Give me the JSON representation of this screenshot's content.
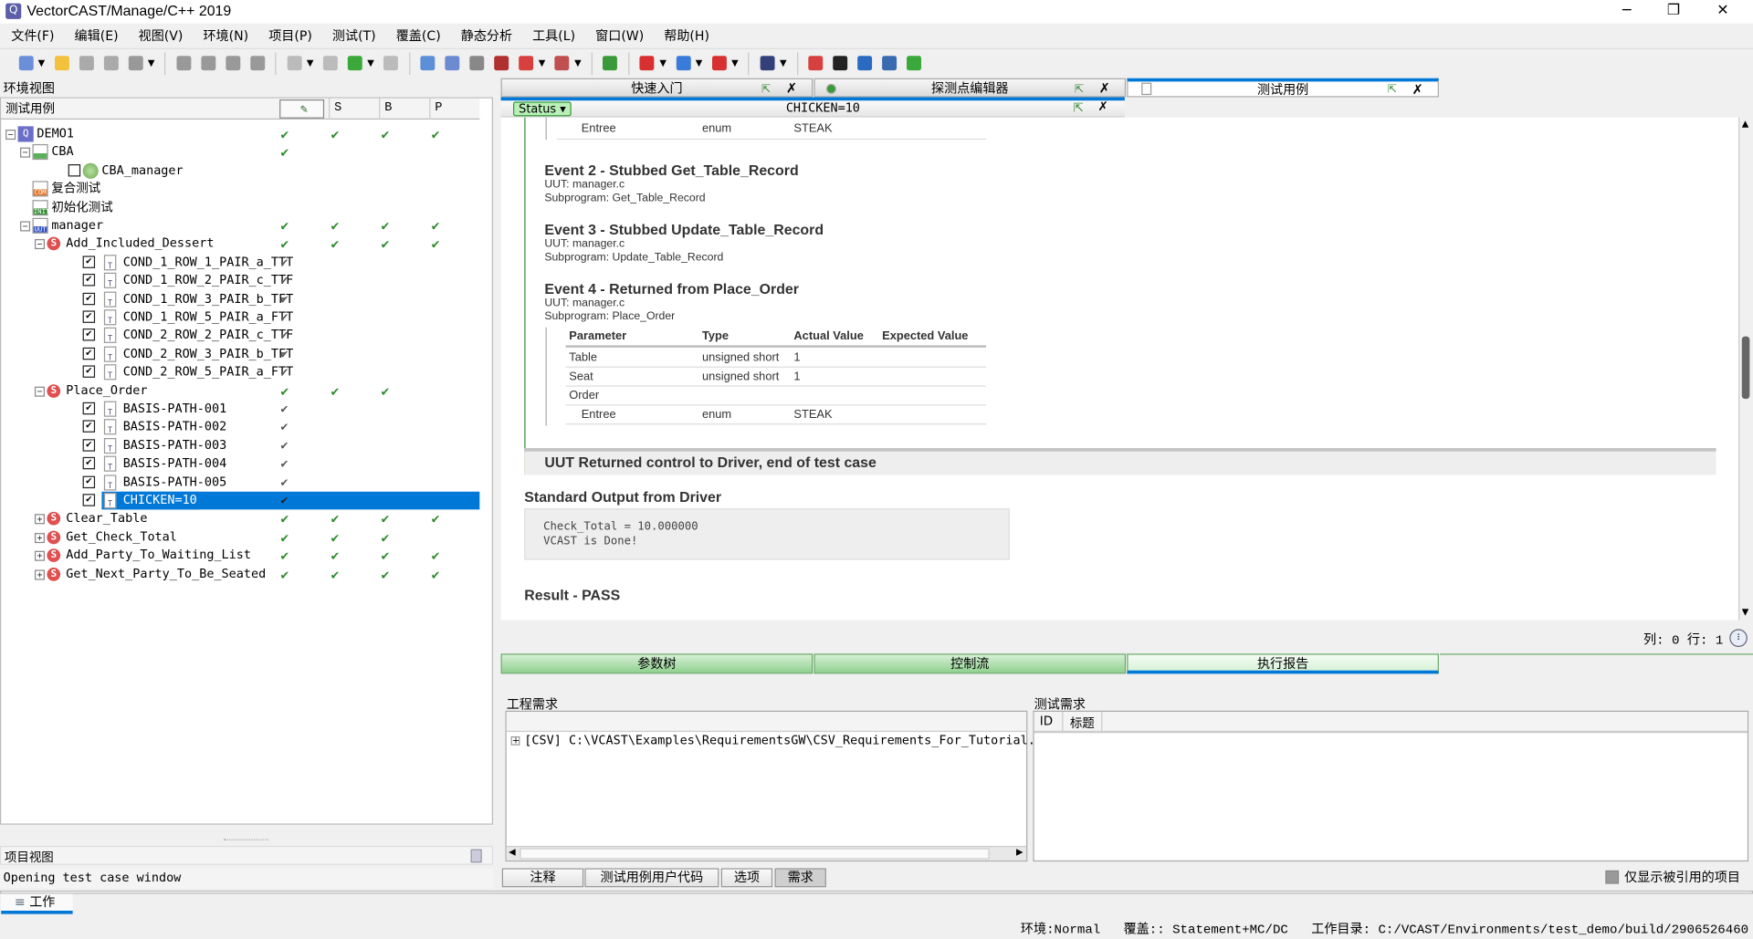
{
  "window": {
    "title": "VectorCAST/Manage/C++ 2019",
    "minimize": "─",
    "restore": "❐",
    "close": "✕"
  },
  "menu": [
    "文件(F)",
    "编辑(E)",
    "视图(V)",
    "环境(N)",
    "项目(P)",
    "测试(T)",
    "覆盖(C)",
    "静态分析",
    "工具(L)",
    "窗口(W)",
    "帮助(H)"
  ],
  "toolbar": [
    {
      "icon": "new-icon",
      "color": "#6a8fd8",
      "dd": true
    },
    {
      "icon": "open-folder-icon",
      "color": "#f2c23c"
    },
    {
      "icon": "save-icon",
      "color": "#aaa"
    },
    {
      "icon": "save-all-icon",
      "color": "#aaa"
    },
    {
      "icon": "print-icon",
      "color": "#999",
      "dd": true
    },
    {
      "sep": true
    },
    {
      "icon": "arrow-down-icon",
      "color": "#999"
    },
    {
      "icon": "arrow-up-icon",
      "color": "#999"
    },
    {
      "icon": "arrow-down-icon",
      "color": "#999"
    },
    {
      "icon": "arrow-up-icon",
      "color": "#999"
    },
    {
      "sep": true
    },
    {
      "icon": "script-icon",
      "color": "#bbb",
      "dd": true
    },
    {
      "icon": "report-icon",
      "color": "#bbb"
    },
    {
      "icon": "execute-icon",
      "color": "#3aa83a",
      "dd": true
    },
    {
      "icon": "tools-icon",
      "color": "#bbb"
    },
    {
      "sep": true
    },
    {
      "icon": "edit-icon",
      "color": "#5b8fd8"
    },
    {
      "icon": "window-icon",
      "color": "#6c8ad0"
    },
    {
      "icon": "tree-icon",
      "color": "#888"
    },
    {
      "icon": "variable-icon",
      "color": "#b03030"
    },
    {
      "icon": "chart-icon",
      "color": "#d84040",
      "dd": true
    },
    {
      "icon": "table-icon",
      "color": "#c05050",
      "dd": true
    },
    {
      "sep": true
    },
    {
      "icon": "search-icon",
      "color": "#3a9a3a"
    },
    {
      "sep": true
    },
    {
      "icon": "stub-icon",
      "color": "#d83030",
      "dd": true
    },
    {
      "icon": "tool-icon",
      "color": "#3a7ad8",
      "dd": true
    },
    {
      "icon": "check-icon",
      "color": "#d83030",
      "dd": true
    },
    {
      "sep": true
    },
    {
      "icon": "play-icon",
      "color": "#34407a",
      "dd": true
    },
    {
      "sep": true
    },
    {
      "icon": "bug-icon",
      "color": "#d84040"
    },
    {
      "icon": "terminal-icon",
      "color": "#222"
    },
    {
      "icon": "database-icon",
      "color": "#2a6ac0"
    },
    {
      "icon": "gear-icon",
      "color": "#3a6ab0"
    },
    {
      "icon": "add-icon",
      "color": "#3aa83a"
    }
  ],
  "left": {
    "env_view": "环境视图",
    "columns": [
      "测试用例",
      "S",
      "B",
      "P"
    ],
    "rows": [
      {
        "level": 0,
        "exp": "-",
        "icon": "env",
        "label": "DEMO1",
        "checks": [
          1,
          1,
          1,
          1
        ]
      },
      {
        "level": 1,
        "exp": "-",
        "icon": "doc",
        "label": "CBA",
        "checks": [
          1,
          0,
          0,
          0
        ]
      },
      {
        "level": 2,
        "cb": "",
        "icon": "cba",
        "label": "CBA_manager",
        "checks": [
          0,
          0,
          0,
          0
        ]
      },
      {
        "level": 1,
        "icon": "com",
        "label": "复合测试",
        "checks": [
          0,
          0,
          0,
          0
        ]
      },
      {
        "level": 1,
        "icon": "init",
        "label": "初始化测试",
        "checks": [
          0,
          0,
          0,
          0
        ]
      },
      {
        "level": 1,
        "exp": "-",
        "icon": "uut",
        "label": "manager",
        "checks": [
          1,
          1,
          1,
          1
        ]
      },
      {
        "level": 2,
        "exp": "-",
        "icon": "s",
        "label": "Add_Included_Dessert",
        "checks": [
          1,
          1,
          1,
          1
        ]
      },
      {
        "level": 3,
        "cb": "✔",
        "icon": "t",
        "label": "COND_1_ROW_1_PAIR_a_TTT",
        "checks": [
          2,
          0,
          0,
          0
        ]
      },
      {
        "level": 3,
        "cb": "✔",
        "icon": "t",
        "label": "COND_1_ROW_2_PAIR_c_TTF",
        "checks": [
          2,
          0,
          0,
          0
        ]
      },
      {
        "level": 3,
        "cb": "✔",
        "icon": "t",
        "label": "COND_1_ROW_3_PAIR_b_TFT",
        "checks": [
          2,
          0,
          0,
          0
        ]
      },
      {
        "level": 3,
        "cb": "✔",
        "icon": "t",
        "label": "COND_1_ROW_5_PAIR_a_FTT",
        "checks": [
          2,
          0,
          0,
          0
        ]
      },
      {
        "level": 3,
        "cb": "✔",
        "icon": "t",
        "label": "COND_2_ROW_2_PAIR_c_TTF",
        "checks": [
          2,
          0,
          0,
          0
        ]
      },
      {
        "level": 3,
        "cb": "✔",
        "icon": "t",
        "label": "COND_2_ROW_3_PAIR_b_TFT",
        "checks": [
          2,
          0,
          0,
          0
        ]
      },
      {
        "level": 3,
        "cb": "✔",
        "icon": "t",
        "label": "COND_2_ROW_5_PAIR_a_FTT",
        "checks": [
          2,
          0,
          0,
          0
        ]
      },
      {
        "level": 2,
        "exp": "-",
        "icon": "s",
        "label": "Place_Order",
        "checks": [
          1,
          1,
          1,
          0
        ]
      },
      {
        "level": 3,
        "cb": "✔",
        "icon": "t",
        "label": "BASIS-PATH-001",
        "checks": [
          2,
          0,
          0,
          0
        ]
      },
      {
        "level": 3,
        "cb": "✔",
        "icon": "t",
        "label": "BASIS-PATH-002",
        "checks": [
          2,
          0,
          0,
          0
        ]
      },
      {
        "level": 3,
        "cb": "✔",
        "icon": "t",
        "label": "BASIS-PATH-003",
        "checks": [
          2,
          0,
          0,
          0
        ]
      },
      {
        "level": 3,
        "cb": "✔",
        "icon": "t",
        "label": "BASIS-PATH-004",
        "checks": [
          2,
          0,
          0,
          0
        ]
      },
      {
        "level": 3,
        "cb": "✔",
        "icon": "t",
        "label": "BASIS-PATH-005",
        "checks": [
          2,
          0,
          0,
          0
        ]
      },
      {
        "level": 3,
        "cb": "✔",
        "icon": "t",
        "label": "CHICKEN=10",
        "checks": [
          2,
          0,
          0,
          0
        ],
        "selected": true
      },
      {
        "level": 2,
        "exp": "+",
        "icon": "s",
        "label": "Clear_Table",
        "checks": [
          1,
          1,
          1,
          1
        ]
      },
      {
        "level": 2,
        "exp": "+",
        "icon": "s",
        "label": "Get_Check_Total",
        "checks": [
          1,
          1,
          1,
          0
        ]
      },
      {
        "level": 2,
        "exp": "+",
        "icon": "s",
        "label": "Add_Party_To_Waiting_List",
        "checks": [
          1,
          1,
          1,
          1
        ]
      },
      {
        "level": 2,
        "exp": "+",
        "icon": "s",
        "label": "Get_Next_Party_To_Be_Seated",
        "checks": [
          1,
          1,
          1,
          1
        ]
      }
    ],
    "project_view": "项目视图",
    "status_message": "Opening test case window"
  },
  "tabs": [
    {
      "label": "快速入门",
      "active": false
    },
    {
      "label": "探测点编辑器",
      "active": false
    },
    {
      "label": "测试用例",
      "active": true
    }
  ],
  "subtab": {
    "status_button": "Status ▾",
    "title": "CHICKEN=10"
  },
  "report": {
    "top_row": {
      "param": "Entree",
      "type": "enum",
      "value": "STEAK"
    },
    "events": [
      {
        "title": "Event 2 - Stubbed Get_Table_Record",
        "uut": "UUT: manager.c",
        "sub": "Subprogram: Get_Table_Record"
      },
      {
        "title": "Event 3 - Stubbed Update_Table_Record",
        "uut": "UUT: manager.c",
        "sub": "Subprogram: Update_Table_Record"
      },
      {
        "title": "Event 4 - Returned from Place_Order",
        "uut": "UUT: manager.c",
        "sub": "Subprogram: Place_Order"
      }
    ],
    "table_headers": [
      "Parameter",
      "Type",
      "Actual Value",
      "Expected Value"
    ],
    "table_rows": [
      {
        "param": "Table",
        "type": "unsigned short",
        "actual": "1",
        "expected": ""
      },
      {
        "param": "Seat",
        "type": "unsigned short",
        "actual": "1",
        "expected": ""
      },
      {
        "param": "Order",
        "type": "",
        "actual": "",
        "expected": ""
      },
      {
        "param": "Entree",
        "type": "enum",
        "actual": "STEAK",
        "expected": "",
        "indent": true
      }
    ],
    "returned": "UUT Returned control to Driver, end of test case",
    "stdout_title": "Standard Output from Driver",
    "stdout_lines": [
      "Check_Total = 10.000000",
      "VCAST is Done!"
    ],
    "result": "Result - PASS"
  },
  "position": "列: 0 行: 1",
  "bottom_tabs": [
    {
      "label": "参数树",
      "active": false
    },
    {
      "label": "控制流",
      "active": false
    },
    {
      "label": "执行报告",
      "active": true
    }
  ],
  "requirements": {
    "project_label": "工程需求",
    "project_item": "[CSV] C:\\VCAST\\Examples\\RequirementsGW\\CSV_Requirements_For_Tutorial.",
    "test_label": "测试需求",
    "test_columns": [
      "ID",
      "标题"
    ]
  },
  "bottom_buttons": [
    {
      "label": "注释",
      "pressed": false
    },
    {
      "label": "测试用例用户代码",
      "pressed": false
    },
    {
      "label": "选项",
      "pressed": false
    },
    {
      "label": "需求",
      "pressed": true
    }
  ],
  "only_referenced": "仅显示被引用的项目",
  "work_tab": "工作",
  "statusbar": {
    "env": "环境:Normal",
    "coverage": "覆盖:: Statement+MC/DC",
    "workdir": "工作目录: C:/VCAST/Environments/test_demo/build/2906526460"
  }
}
